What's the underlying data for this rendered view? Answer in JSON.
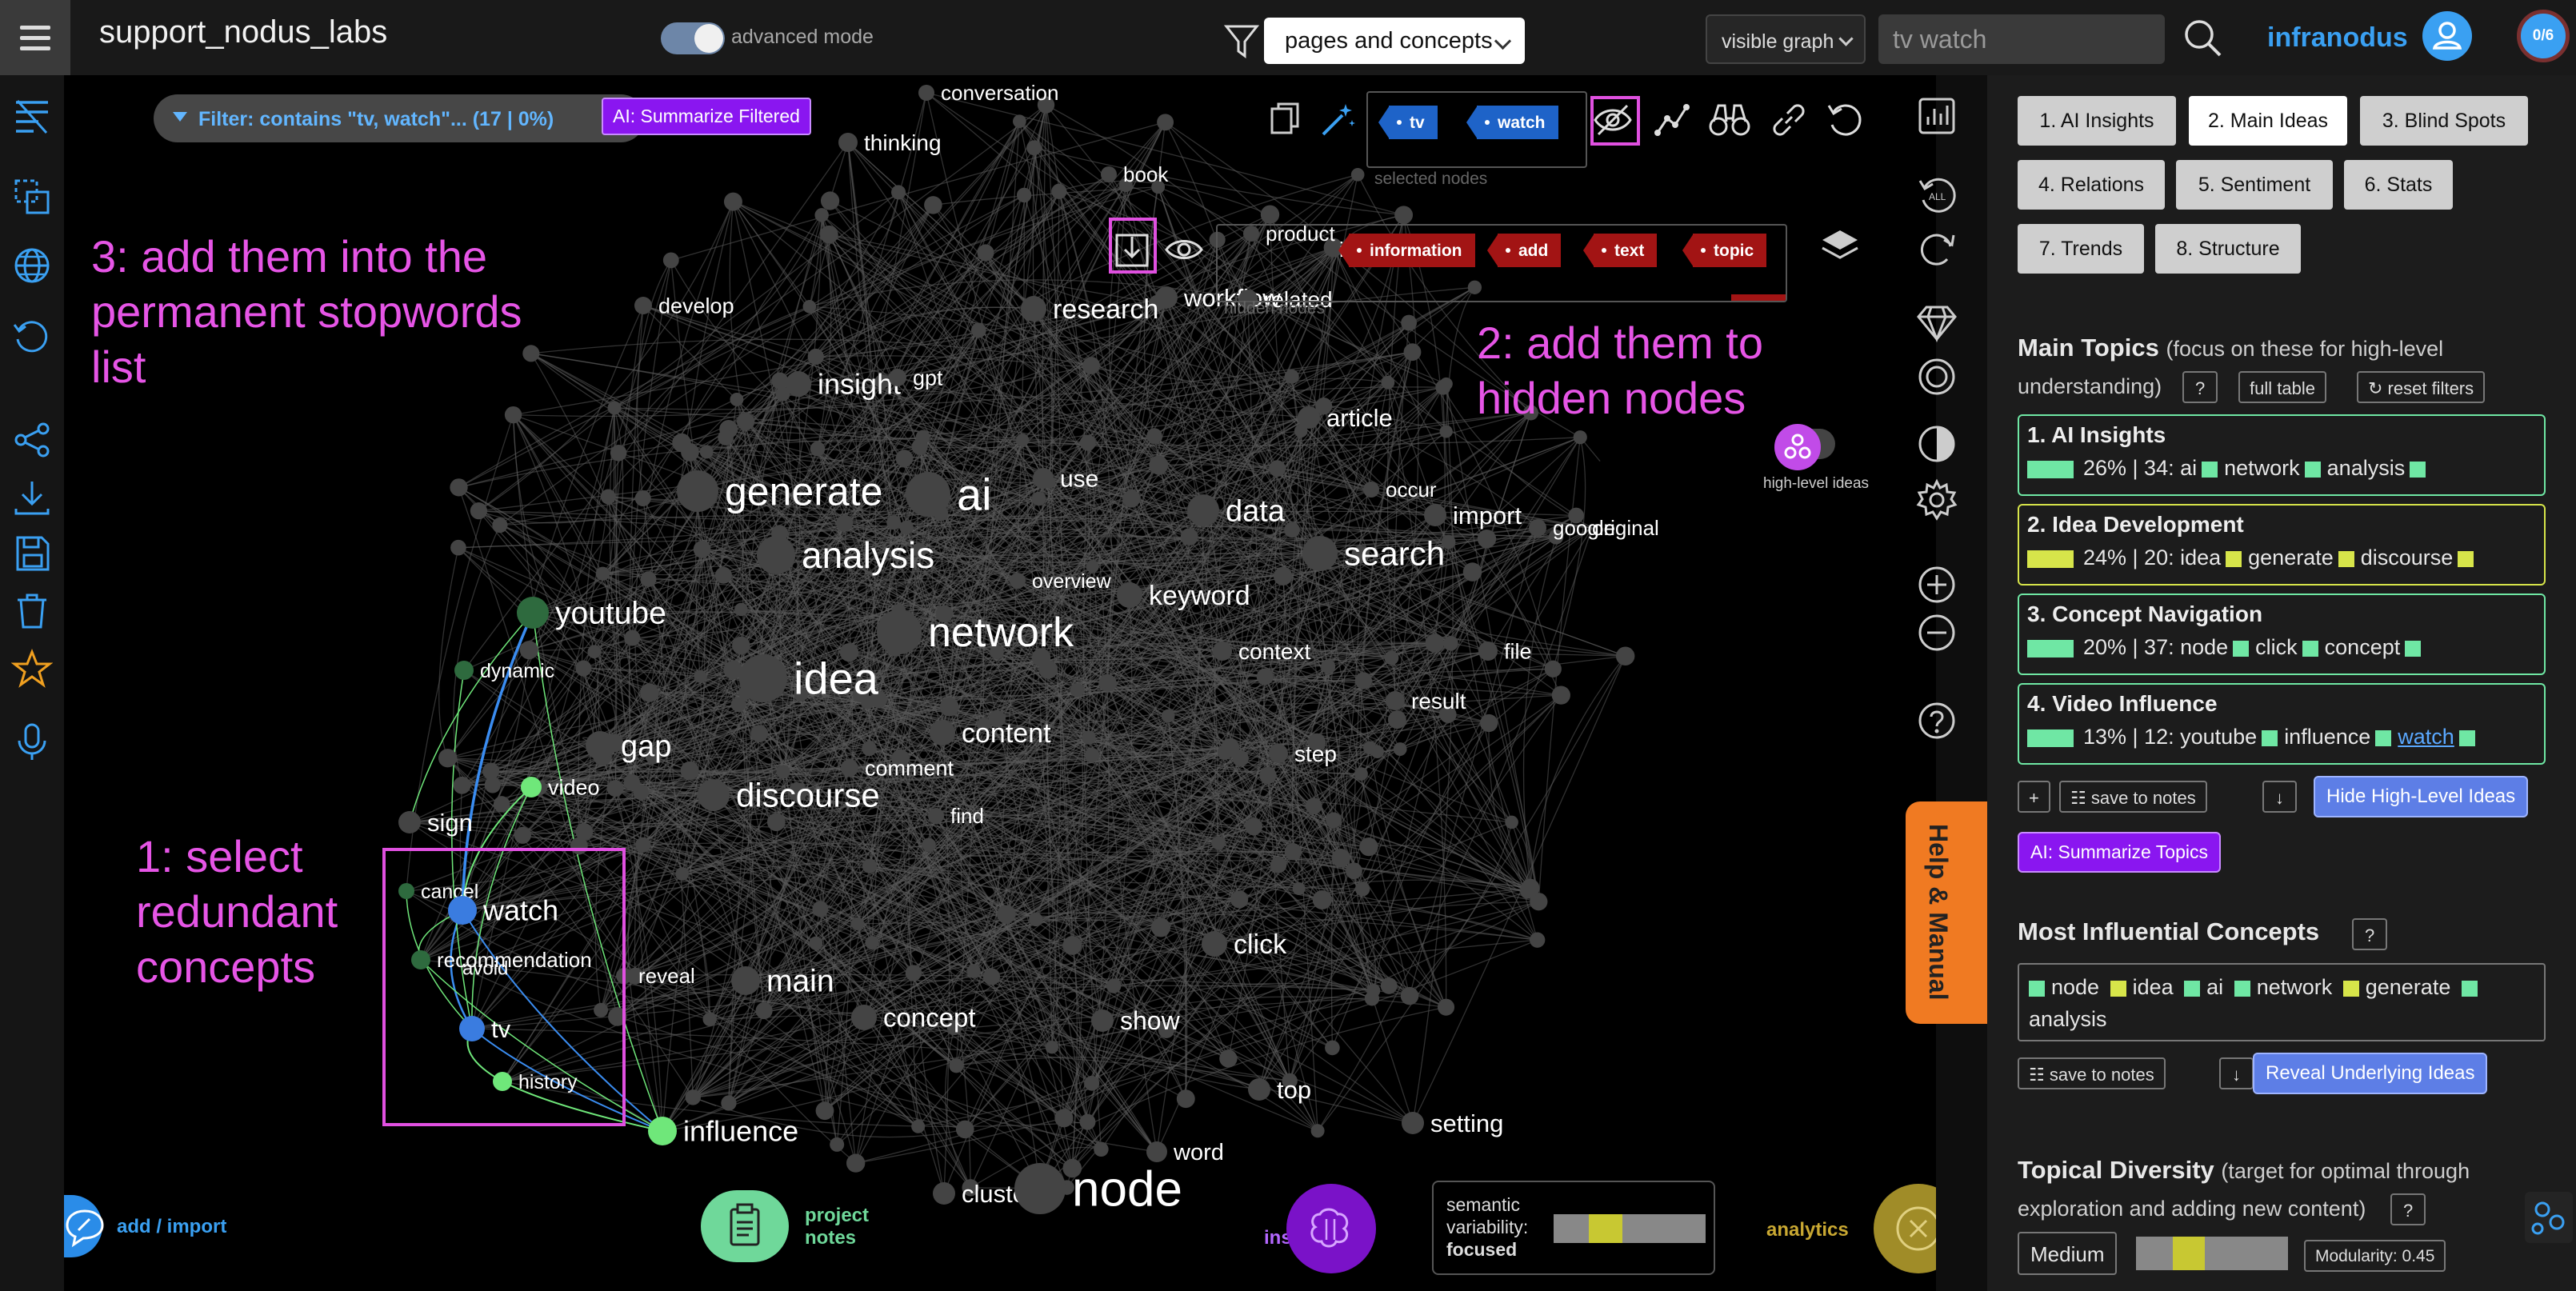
{
  "header": {
    "title": "support_nodus_labs",
    "advanced_mode_label": "advanced mode",
    "view_select": "pages and concepts",
    "graph_select": "visible graph",
    "search_value": "tv watch",
    "brand": "infranodus",
    "counter": "0/6"
  },
  "graph": {
    "filter_label": "Filter: contains \"tv, watch\"... (17 | 0%)",
    "ai_summarize_filtered": "AI: Summarize Filtered",
    "selected_nodes_label": "selected nodes",
    "selected_nodes": [
      "tv",
      "watch"
    ],
    "hidden_nodes_label": "hidden nodes",
    "hidden_nodes": [
      "information",
      "add",
      "text",
      "topic"
    ],
    "high_level_ideas_label": "high-level ideas",
    "annotations": {
      "step1": [
        "1: select",
        "redundant",
        "concepts"
      ],
      "step2": [
        "2: add them to",
        "hidden nodes"
      ],
      "step3": [
        "3: add them into the",
        "permanent stopwords",
        "list"
      ]
    },
    "bottom": {
      "add_import_label": "add / import",
      "project_notes_label": [
        "project",
        "notes"
      ],
      "ai_insights_label": [
        "AI",
        "insights"
      ],
      "variability_label": [
        "semantic",
        "variability:"
      ],
      "variability_value": "focused",
      "analytics_label": "analytics"
    }
  },
  "nodes": [
    {
      "label": "conversation",
      "size": 26,
      "color": "#ffffff"
    },
    {
      "label": "thinking",
      "size": 28,
      "color": "#ffffff"
    },
    {
      "label": "book",
      "size": 26,
      "color": "#ffffff"
    },
    {
      "label": "product",
      "size": 26,
      "color": "#ffffff"
    },
    {
      "label": "information",
      "size": 26,
      "color": "#ffffff"
    },
    {
      "label": "develop",
      "size": 27,
      "color": "#ffffff"
    },
    {
      "label": "research",
      "size": 34,
      "color": "#ffffff"
    },
    {
      "label": "workflow",
      "size": 31,
      "color": "#ffffff"
    },
    {
      "label": "related",
      "size": 28,
      "color": "#ffffff"
    },
    {
      "label": "insight",
      "size": 36,
      "color": "#ffffff"
    },
    {
      "label": "gpt",
      "size": 27,
      "color": "#ffffff"
    },
    {
      "label": "article",
      "size": 31,
      "color": "#ffffff"
    },
    {
      "label": "generate",
      "size": 50,
      "color": "#ffffff"
    },
    {
      "label": "ai",
      "size": 56,
      "color": "#ffffff"
    },
    {
      "label": "use",
      "size": 30,
      "color": "#ffffff"
    },
    {
      "label": "occur",
      "size": 26,
      "color": "#ffffff"
    },
    {
      "label": "data",
      "size": 38,
      "color": "#ffffff"
    },
    {
      "label": "import",
      "size": 31,
      "color": "#ffffff"
    },
    {
      "label": "google",
      "size": 26,
      "color": "#ffffff"
    },
    {
      "label": "original",
      "size": 26,
      "color": "#ffffff"
    },
    {
      "label": "analysis",
      "size": 46,
      "color": "#ffffff"
    },
    {
      "label": "search",
      "size": 42,
      "color": "#ffffff"
    },
    {
      "label": "overview",
      "size": 25,
      "color": "#ffffff"
    },
    {
      "label": "keyword",
      "size": 34,
      "color": "#ffffff"
    },
    {
      "label": "youtube",
      "size": 39,
      "color": "#ffffff"
    },
    {
      "label": "network",
      "size": 52,
      "color": "#ffffff"
    },
    {
      "label": "dynamic",
      "size": 25,
      "color": "#ffffff"
    },
    {
      "label": "context",
      "size": 28,
      "color": "#ffffff"
    },
    {
      "label": "file",
      "size": 27,
      "color": "#ffffff"
    },
    {
      "label": "idea",
      "size": 56,
      "color": "#ffffff"
    },
    {
      "label": "result",
      "size": 28,
      "color": "#ffffff"
    },
    {
      "label": "content",
      "size": 34,
      "color": "#ffffff"
    },
    {
      "label": "gap",
      "size": 38,
      "color": "#ffffff"
    },
    {
      "label": "step",
      "size": 28,
      "color": "#ffffff"
    },
    {
      "label": "comment",
      "size": 27,
      "color": "#ffffff"
    },
    {
      "label": "discourse",
      "size": 42,
      "color": "#ffffff"
    },
    {
      "label": "video",
      "size": 27,
      "color": "#ffffff"
    },
    {
      "label": "find",
      "size": 26,
      "color": "#ffffff"
    },
    {
      "label": "sign",
      "size": 31,
      "color": "#ffffff"
    },
    {
      "label": "cancel",
      "size": 25,
      "color": "#ffffff"
    },
    {
      "label": "watch",
      "size": 36,
      "color": "#ffffff"
    },
    {
      "label": "recommendation",
      "size": 26,
      "color": "#ffffff"
    },
    {
      "label": "avoid",
      "size": 24,
      "color": "#ffffff"
    },
    {
      "label": "reveal",
      "size": 26,
      "color": "#ffffff"
    },
    {
      "label": "main",
      "size": 39,
      "color": "#ffffff"
    },
    {
      "label": "click",
      "size": 34,
      "color": "#ffffff"
    },
    {
      "label": "tv",
      "size": 31,
      "color": "#ffffff"
    },
    {
      "label": "concept",
      "size": 33,
      "color": "#ffffff"
    },
    {
      "label": "show",
      "size": 32,
      "color": "#ffffff"
    },
    {
      "label": "history",
      "size": 25,
      "color": "#ffffff"
    },
    {
      "label": "top",
      "size": 31,
      "color": "#ffffff"
    },
    {
      "label": "influence",
      "size": 36,
      "color": "#ffffff"
    },
    {
      "label": "setting",
      "size": 31,
      "color": "#ffffff"
    },
    {
      "label": "word",
      "size": 29,
      "color": "#ffffff"
    },
    {
      "label": "cluster",
      "size": 31,
      "color": "#ffffff"
    },
    {
      "label": "node",
      "size": 62,
      "color": "#ffffff"
    }
  ],
  "panel": {
    "tabs": [
      "1. AI Insights",
      "2. Main Ideas",
      "3. Blind Spots",
      "4. Relations",
      "5. Sentiment",
      "6. Stats",
      "7. Trends",
      "8. Structure"
    ],
    "main_topics_title": "Main Topics",
    "main_topics_sub": "(focus on these for high-level",
    "main_topics_sub2": "understanding)",
    "help_q": "?",
    "full_table": "full table",
    "reset_filters": "↻ reset filters",
    "topics": [
      {
        "title": "1. AI Insights",
        "detail": "26% | 34: ai",
        "w1": "network",
        "w2": "analysis"
      },
      {
        "title": "2. Idea Development",
        "detail": "24% | 20: idea",
        "w1": "generate",
        "w2": "discourse"
      },
      {
        "title": "3. Concept Navigation",
        "detail": "20% | 37: node",
        "w1": "click",
        "w2": "concept"
      },
      {
        "title": "4. Video Influence",
        "detail": "13% | 12: youtube",
        "w1": "influence",
        "w2": "watch"
      }
    ],
    "plus": "+",
    "save_to_notes": "☷ save to notes",
    "down_arrow": "↓",
    "hide_high_level": "Hide High-Level Ideas",
    "ai_summarize_topics": "AI: Summarize Topics",
    "influential_title": "Most Influential Concepts",
    "influential_words": [
      "node",
      "idea",
      "ai",
      "network",
      "generate",
      "analysis"
    ],
    "reveal_underlying": "Reveal Underlying Ideas",
    "diversity_title": "Topical Diversity",
    "diversity_sub": "(target for optimal through",
    "diversity_sub2": "exploration and adding new content)",
    "diversity_value": "Medium",
    "modularity": "Modularity: 0.45",
    "help_manual": "Help & Manual"
  },
  "colors": {
    "accent_blue": "#3aa0f2",
    "green_topic": "#6fe7a4",
    "yellow_topic": "#d7e54a",
    "annotation_magenta": "#e655e6",
    "selected_blue": "#1e63c8",
    "hidden_red": "#a21414"
  }
}
